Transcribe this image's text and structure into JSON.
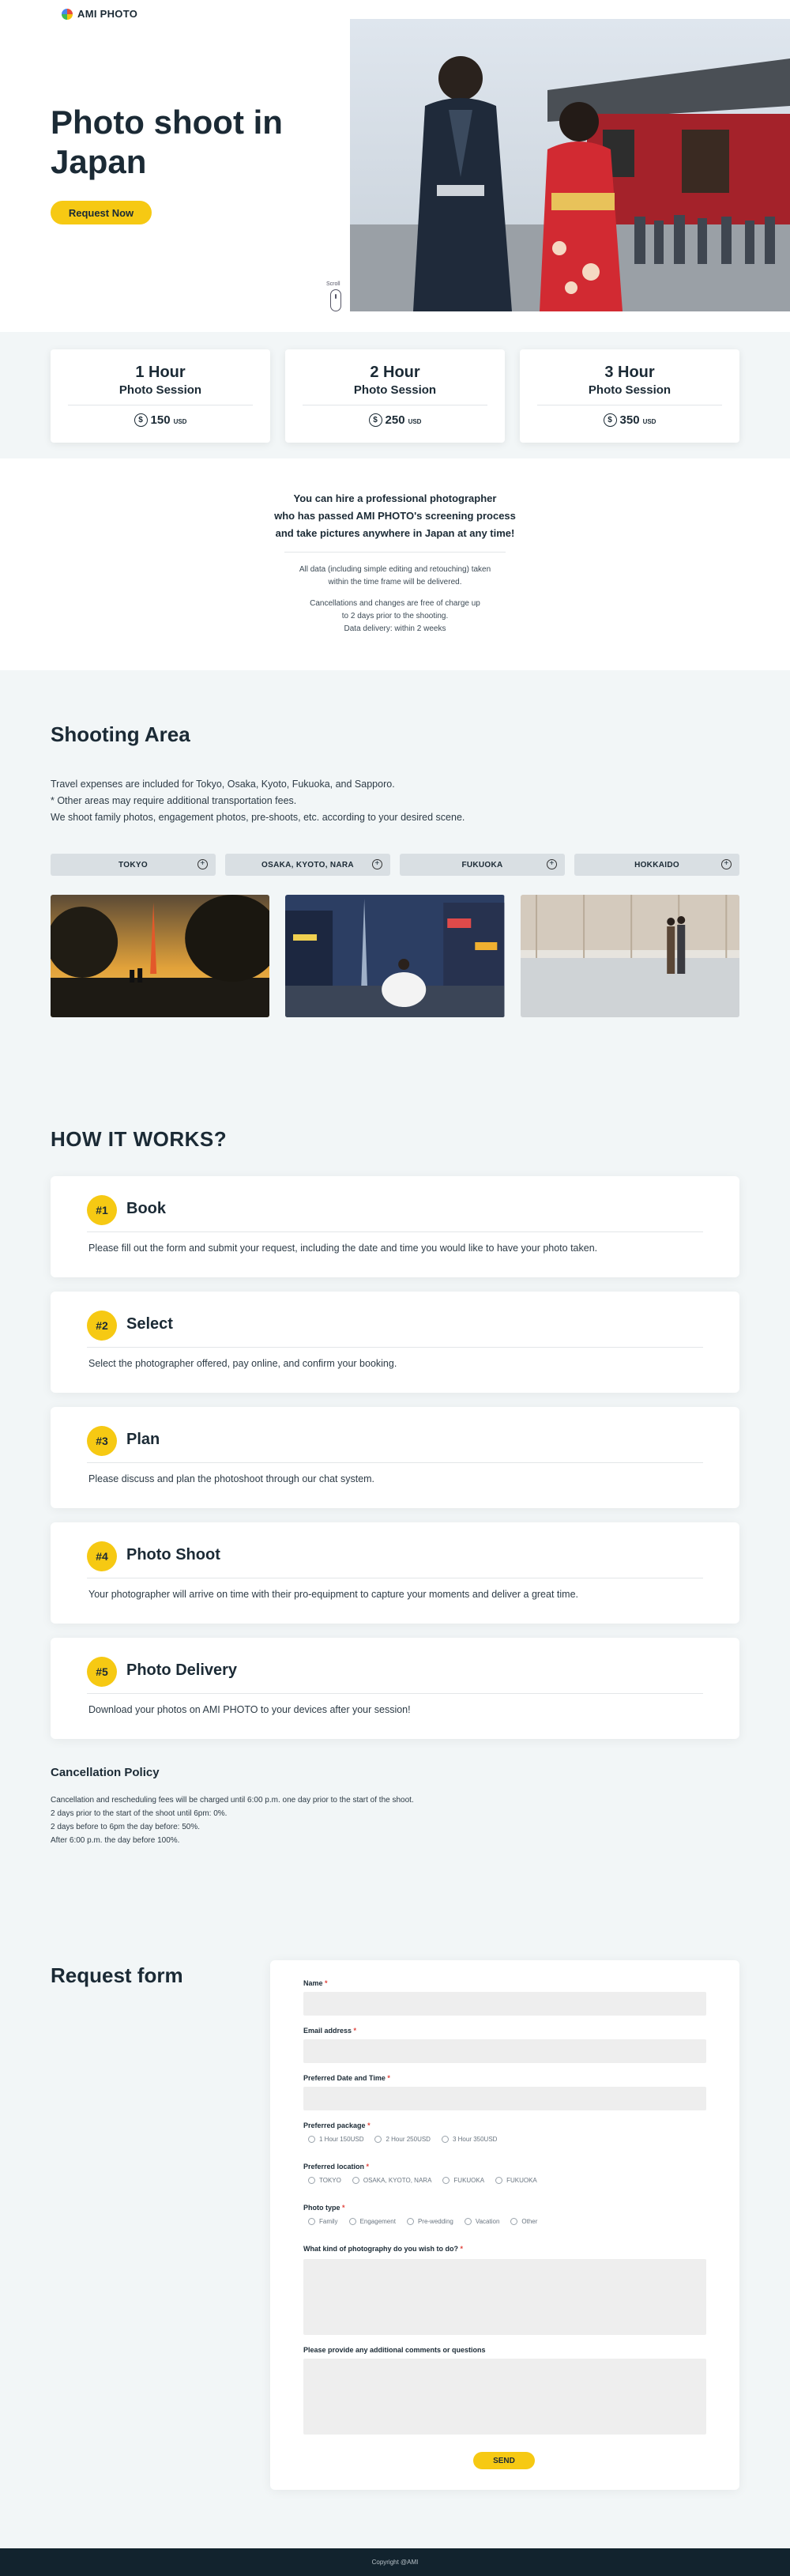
{
  "header": {
    "brand": "AMI PHOTO"
  },
  "hero": {
    "title": "Photo shoot in Japan",
    "cta_label": "Request Now",
    "scroll_label": "Scroll"
  },
  "packages": [
    {
      "hours": "1 Hour",
      "label": "Photo Session",
      "price": "150",
      "currency": "USD"
    },
    {
      "hours": "2 Hour",
      "label": "Photo Session",
      "price": "250",
      "currency": "USD"
    },
    {
      "hours": "3 Hour",
      "label": "Photo Session",
      "price": "350",
      "currency": "USD"
    }
  ],
  "intro": {
    "lead": [
      "You can hire a professional photographer",
      "who has passed AMI PHOTO's screening process",
      "and take pictures anywhere in Japan at any time!"
    ],
    "note1": [
      "All data (including simple editing and retouching) taken",
      "within the time frame will be delivered."
    ],
    "note2": [
      "Cancellations and changes are free of charge up",
      "to 2 days prior to the shooting.",
      "Data delivery: within 2 weeks"
    ]
  },
  "area": {
    "title": "Shooting Area",
    "desc": [
      "Travel expenses are included for Tokyo, Osaka, Kyoto, Fukuoka, and Sapporo.",
      "* Other areas may require additional transportation fees.",
      "We shoot family photos, engagement photos, pre-shoots, etc. according to your desired scene."
    ],
    "tabs": [
      "TOKYO",
      "OSAKA, KYOTO, NARA",
      "FUKUOKA",
      "HOKKAIDO"
    ]
  },
  "how": {
    "title": "HOW IT WORKS?",
    "steps": [
      {
        "num": "#1",
        "title": "Book",
        "text": "Please fill out the form and submit your request, including the date and time you would like to have your photo taken."
      },
      {
        "num": "#2",
        "title": "Select",
        "text": "Select the photographer offered, pay online, and confirm your booking."
      },
      {
        "num": "#3",
        "title": "Plan",
        "text": "Please discuss and plan the photoshoot through our chat system."
      },
      {
        "num": "#4",
        "title": "Photo Shoot",
        "text": "Your photographer will arrive on time with their pro-equipment to capture your moments and deliver a great time."
      },
      {
        "num": "#5",
        "title": "Photo Delivery",
        "text": "Download your photos on AMI PHOTO to your devices after your session!"
      }
    ]
  },
  "policy": {
    "title": "Cancellation Policy",
    "lines": [
      "Cancellation and rescheduling fees will be charged until 6:00 p.m. one day prior to the start of the shoot.",
      "2 days prior to the start of the shoot until 6pm: 0%.",
      "2 days before to 6pm the day before: 50%.",
      "After 6:00 p.m. the day before 100%."
    ]
  },
  "form": {
    "title": "Request form",
    "name_label": "Name",
    "email_label": "Email address",
    "date_label": "Preferred Date and Time",
    "package_label": "Preferred package",
    "package_options": [
      "1 Hour 150USD",
      "2 Hour 250USD",
      "3 Hour 350USD"
    ],
    "location_label": "Preferred location",
    "location_options": [
      "TOKYO",
      "OSAKA, KYOTO, NARA",
      "FUKUOKA",
      "FUKUOKA"
    ],
    "type_label": "Photo type",
    "type_options": [
      "Family",
      "Engagement",
      "Pre-wedding",
      "Vacation",
      "Other"
    ],
    "wish_label": "What kind of photography do you wish to do?",
    "comments_label": "Please provide any additional comments or questions",
    "required_mark": "*",
    "send_label": "SEND"
  },
  "footer": {
    "copyright": "Copyright @AMI"
  },
  "colors": {
    "accent": "#f6c913",
    "dark": "#1b2a35",
    "bg_light": "#f2f6f7",
    "footer": "#12232e"
  }
}
